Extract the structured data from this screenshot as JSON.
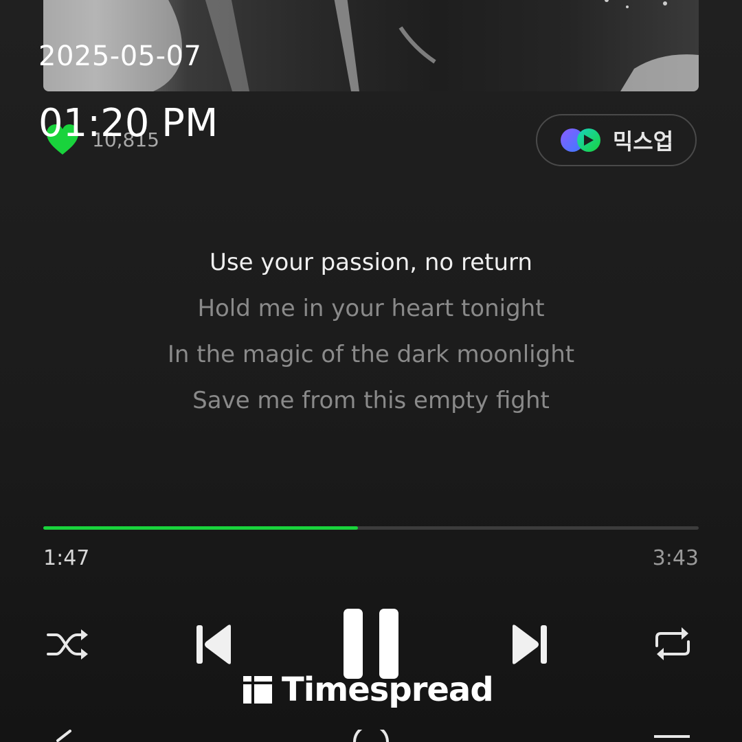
{
  "overlay": {
    "date": "2025-05-07",
    "time": "01:20 PM"
  },
  "likes": {
    "count": "10,815",
    "icon": "heart-icon",
    "color": "#19d33c"
  },
  "mixup": {
    "label": "믹스업",
    "icon": "mixup-icon"
  },
  "lyrics": {
    "lines": [
      "Use your passion, no return",
      "Hold me in your heart tonight",
      "In the magic of the dark moonlight",
      "Save me from this empty fight"
    ],
    "current_index": 0
  },
  "playback": {
    "elapsed": "1:47",
    "total": "3:43",
    "progress": 0.48,
    "accent_color": "#19d33c"
  },
  "controls": {
    "shuffle": "shuffle-icon",
    "previous": "skip-previous-icon",
    "play_pause": "pause-icon",
    "next": "skip-next-icon",
    "repeat": "repeat-icon"
  },
  "watermark": {
    "text": "Timespread"
  }
}
